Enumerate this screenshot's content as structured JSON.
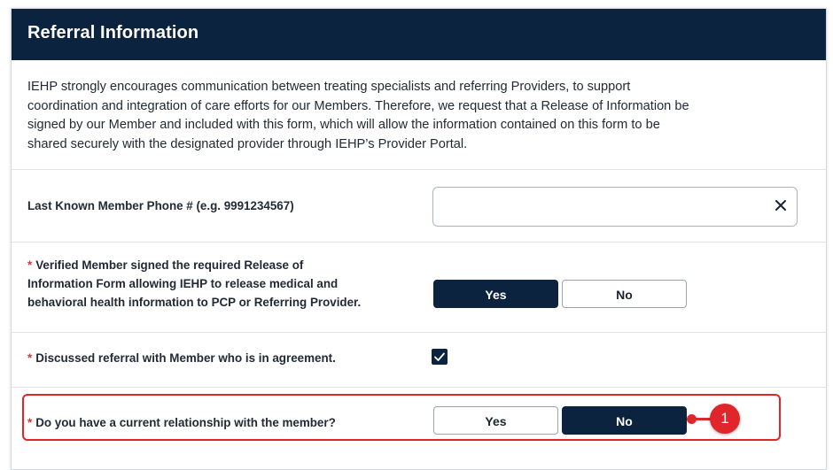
{
  "section": {
    "title": "Referral Information",
    "intro_lines": [
      "IEHP strongly encourages communication between treating specialists and referring Providers, to support",
      "coordination and integration of care efforts for our Members. Therefore, we request that a Release of Information be",
      "signed by our Member and included with this form, which will allow the information contained on this form to be",
      "shared securely with the designated provider through IEHP’s Provider Portal."
    ]
  },
  "fields": {
    "phone": {
      "label": "Last Known Member Phone # (e.g. 9991234567)",
      "value": ""
    },
    "release_form": {
      "required_mark": "*",
      "label_lines": [
        "Verified Member signed the required Release of",
        "Information Form allowing IEHP to release medical and",
        "behavioral health information to PCP or Referring Provider."
      ],
      "yes_label": "Yes",
      "no_label": "No",
      "selected": "Yes"
    },
    "discussed": {
      "required_mark": "*",
      "label": "Discussed referral with Member who is in agreement.",
      "checked": true
    },
    "relationship": {
      "required_mark": "*",
      "label": "Do you have a current relationship with the member?",
      "yes_label": "Yes",
      "no_label": "No",
      "selected": "No"
    }
  },
  "annotation": {
    "badge_number": "1",
    "color": "#e0252b"
  },
  "colors": {
    "header_bg": "#0c2340",
    "selected_button": "#0c2340",
    "required": "#d93838"
  },
  "icons": {
    "clear": "close-icon",
    "check": "checkmark-icon"
  }
}
